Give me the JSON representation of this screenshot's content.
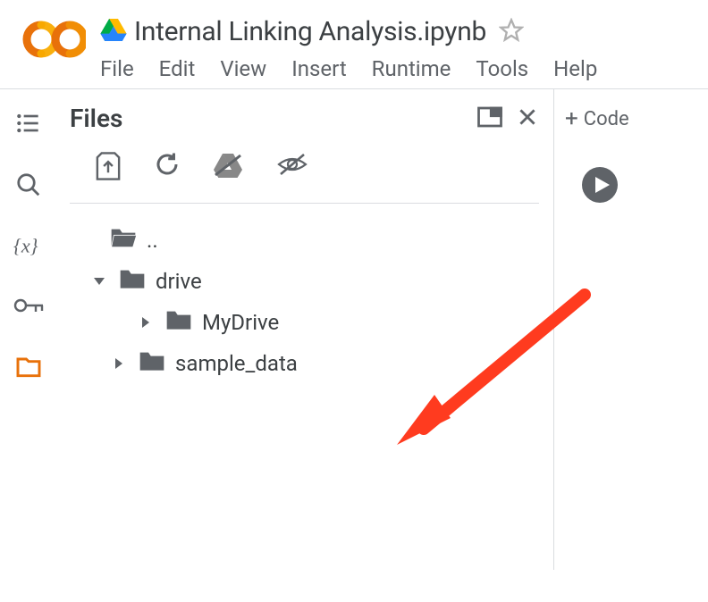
{
  "header": {
    "title": "Internal Linking Analysis.ipynb",
    "menu": [
      "File",
      "Edit",
      "View",
      "Insert",
      "Runtime",
      "Tools",
      "Help"
    ]
  },
  "panel": {
    "title": "Files"
  },
  "tree": {
    "parent_label": "..",
    "drive_label": "drive",
    "mydrive_label": "MyDrive",
    "sample_data_label": "sample_data"
  },
  "actions": {
    "code_label": "Code"
  }
}
